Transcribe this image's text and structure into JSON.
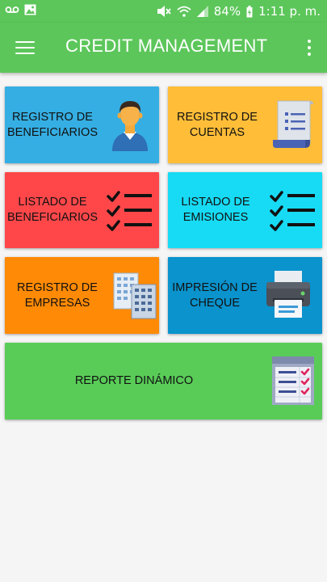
{
  "status": {
    "battery": "84%",
    "time": "1:11 p. m."
  },
  "appbar": {
    "title": "CREDIT MANAGEMENT"
  },
  "tiles": [
    {
      "label": "REGISTRO DE\nBENEFICIARIOS",
      "color": "#35aee3",
      "icon": "person-avatar-icon"
    },
    {
      "label": "REGISTRO DE\nCUENTAS",
      "color": "#ffbd38",
      "icon": "document-scroll-icon"
    },
    {
      "label": "LISTADO DE\nBENEFICIARIOS",
      "color": "#ff474a",
      "icon": "checklist-icon"
    },
    {
      "label": "LISTADO DE\nEMISIONES",
      "color": "#17dbf5",
      "icon": "checklist-icon"
    },
    {
      "label": "REGISTRO DE\nEMPRESAS",
      "color": "#ff8a05",
      "icon": "building-documents-icon"
    },
    {
      "label": "IMPRESIÓN DE\nCHEQUE",
      "color": "#0a93cd",
      "icon": "printer-icon"
    },
    {
      "label": "REPORTE DINÁMICO",
      "color": "#59cc58",
      "icon": "report-checklist-icon"
    }
  ]
}
